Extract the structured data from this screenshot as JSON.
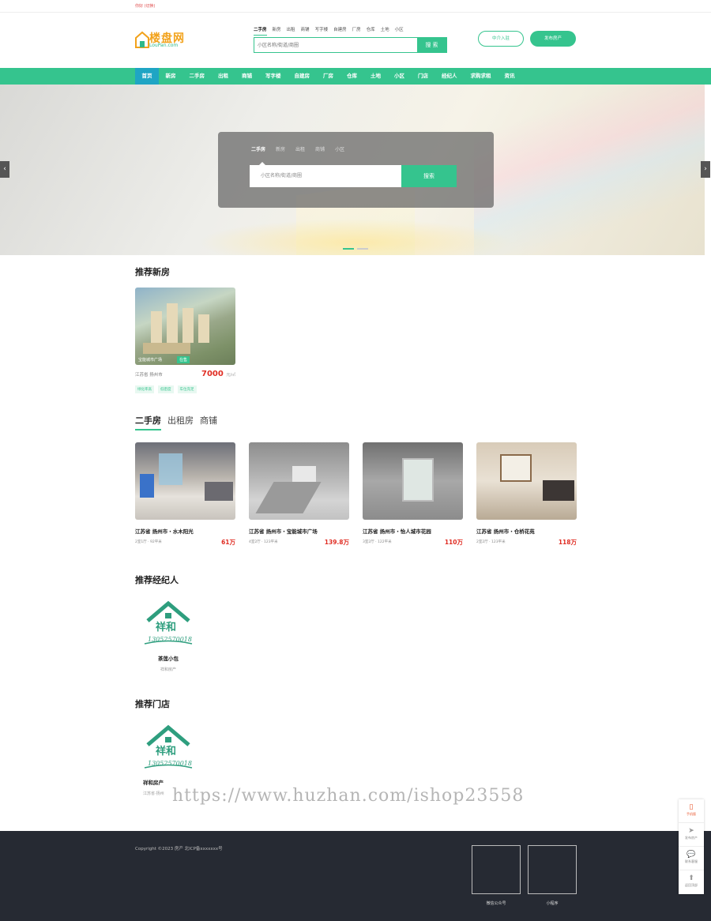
{
  "topbar": {
    "text": "你好 (切换)"
  },
  "header": {
    "logo_text": "楼盘网",
    "logo_sub": "LouPan.com",
    "search_tabs": [
      "二手房",
      "新房",
      "出租",
      "商铺",
      "写字楼",
      "自建房",
      "厂房",
      "仓库",
      "土地",
      "小区"
    ],
    "search_placeholder": "小区名称/街道/商圈",
    "search_button": "搜 索",
    "agent_button": "中介入驻",
    "post_button": "发布房产"
  },
  "nav": [
    "首页",
    "新房",
    "二手房",
    "出租",
    "商铺",
    "写字楼",
    "自建房",
    "厂房",
    "仓库",
    "土地",
    "小区",
    "门店",
    "经纪人",
    "求购求租",
    "资讯"
  ],
  "banner": {
    "tabs": [
      "二手房",
      "新房",
      "出租",
      "商铺",
      "小区"
    ],
    "placeholder": "小区名称/街道/商圈",
    "button": "搜索",
    "prev": "‹",
    "next": "›"
  },
  "new_house": {
    "title": "推荐新房",
    "card": {
      "caption": "宝能城市广场",
      "status": "在售",
      "location": "江苏省 扬州市",
      "price": "7000",
      "unit": "元/㎡",
      "tags": [
        "绿化率高",
        "低密度",
        "车位充足"
      ]
    }
  },
  "second_hand": {
    "tabs": [
      "二手房",
      "出租房",
      "商铺"
    ],
    "cards": [
      {
        "title": "江苏省 扬州市・水木阳光",
        "desc": "2室1厅 · 92平米",
        "price": "61万"
      },
      {
        "title": "江苏省 扬州市・宝能城市广场",
        "desc": "4室2厅 · 123平米",
        "price": "139.8万"
      },
      {
        "title": "江苏省 扬州市・怡人城市花园",
        "desc": "3室2厅 · 122平米",
        "price": "110万"
      },
      {
        "title": "江苏省 扬州市・仓桥花苑",
        "desc": "2室2厅 · 123平米",
        "price": "118万"
      }
    ]
  },
  "agents": {
    "title": "推荐经纪人",
    "name": "茶莲小包",
    "company": "祥和房产",
    "logo_text": "祥和",
    "logo_phone": "13052570018"
  },
  "stores": {
    "title": "推荐门店",
    "name": "祥和房产",
    "address": "江苏省·扬州",
    "logo_text": "祥和",
    "logo_phone": "13052570018"
  },
  "watermark": "https://www.huzhan.com/ishop23558",
  "footer": {
    "copyright": "Copyright ©2023 房产   北ICP备xxxxxxx号",
    "qr1_label": "微信公众号",
    "qr2_label": "小程序"
  },
  "side": [
    "手机版",
    "发布房产",
    "联系客服",
    "返回顶部"
  ],
  "colors": {
    "accent": "#35c48e",
    "price": "#e02e24",
    "footer": "#262a33"
  }
}
